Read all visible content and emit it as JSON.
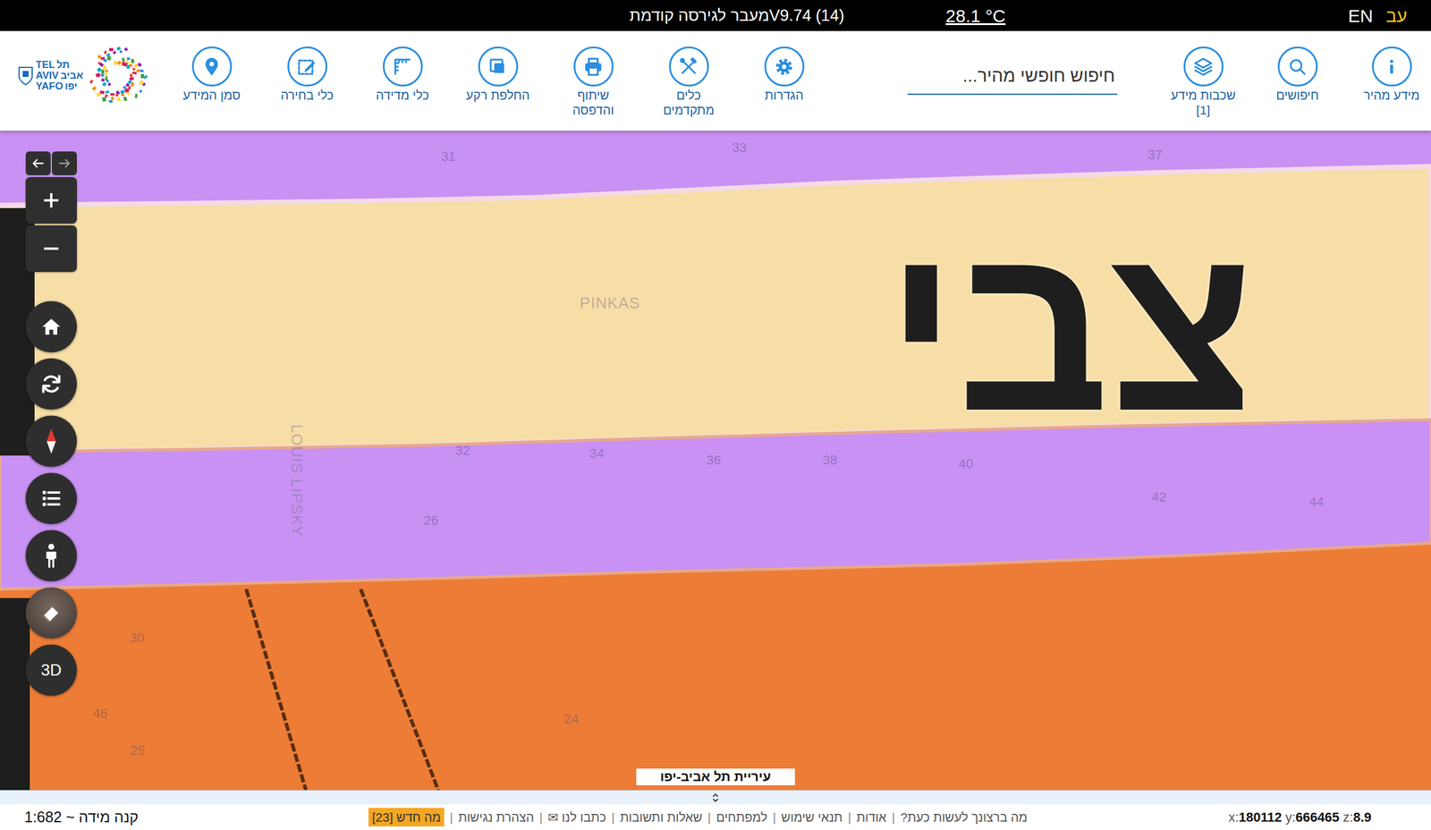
{
  "top_bar": {
    "previous_version": "מעבר לגירסה קודמת",
    "version": "V9.74 (14)",
    "temperature": "28.1 °C",
    "languages": [
      {
        "label": "EN",
        "selected": false
      },
      {
        "label": "עב",
        "selected": true
      }
    ]
  },
  "toolbar": {
    "items_right": [
      {
        "label": "מידע מהיר"
      },
      {
        "label": "חיפושים"
      },
      {
        "label": "שכבות מידע",
        "count": "[1]"
      }
    ],
    "search": {
      "placeholder": "חיפוש חופשי מהיר..."
    },
    "items_left": [
      {
        "label": "הגדרות"
      },
      {
        "label": "כלים מתקדמים"
      },
      {
        "label": "שיתוף והדפסה"
      },
      {
        "label": "החלפת רקע"
      },
      {
        "label": "כלי מדידה"
      },
      {
        "label": "כלי בחירה"
      },
      {
        "label": "סמן המידע"
      }
    ],
    "logo": {
      "lines": [
        {
          "en": "TEL",
          "he": "תל"
        },
        {
          "en": "AVIV",
          "he": "אביב"
        },
        {
          "en": "YAFO",
          "he": "יפו"
        }
      ]
    }
  },
  "map": {
    "street_name": "צבי",
    "labels": [
      {
        "text": "31",
        "kind": "number"
      },
      {
        "text": "33",
        "kind": "number"
      },
      {
        "text": "37",
        "kind": "number"
      },
      {
        "text": "PINKAS",
        "kind": "street"
      },
      {
        "text": "LOUIS LIPSKY",
        "kind": "vertical"
      },
      {
        "text": "32",
        "kind": "number"
      },
      {
        "text": "34",
        "kind": "number"
      },
      {
        "text": "36",
        "kind": "number"
      },
      {
        "text": "38",
        "kind": "number"
      },
      {
        "text": "40",
        "kind": "number"
      },
      {
        "text": "42",
        "kind": "number"
      },
      {
        "text": "44",
        "kind": "number"
      },
      {
        "text": "26",
        "kind": "number"
      },
      {
        "text": "30",
        "kind": "number"
      },
      {
        "text": "46",
        "kind": "number"
      },
      {
        "text": "25",
        "kind": "number"
      },
      {
        "text": "24",
        "kind": "number"
      }
    ],
    "three_d": "3D",
    "attribution": "עיריית תל אביב-יפו"
  },
  "footer": {
    "scale": "קנה מידה ~ 1:682",
    "separator": "|",
    "links": [
      {
        "label": "מה ברצונך לעשות כעת?",
        "highlighted": false
      },
      {
        "label": "אודות",
        "highlighted": false
      },
      {
        "label": "תנאי שימוש",
        "highlighted": false
      },
      {
        "label": "למפתחים",
        "highlighted": false
      },
      {
        "label": "שאלות ותשובות",
        "highlighted": false
      },
      {
        "label": "כתבו לנו ✉",
        "highlighted": false
      },
      {
        "label": "הצהרת נגישות",
        "highlighted": false
      },
      {
        "label": "מה חדש [23]",
        "highlighted": true
      }
    ],
    "coordinates": [
      {
        "axis": "x:",
        "value": "180112"
      },
      {
        "axis": "y:",
        "value": "666465"
      },
      {
        "axis": "z:",
        "value": "8.9"
      }
    ]
  }
}
